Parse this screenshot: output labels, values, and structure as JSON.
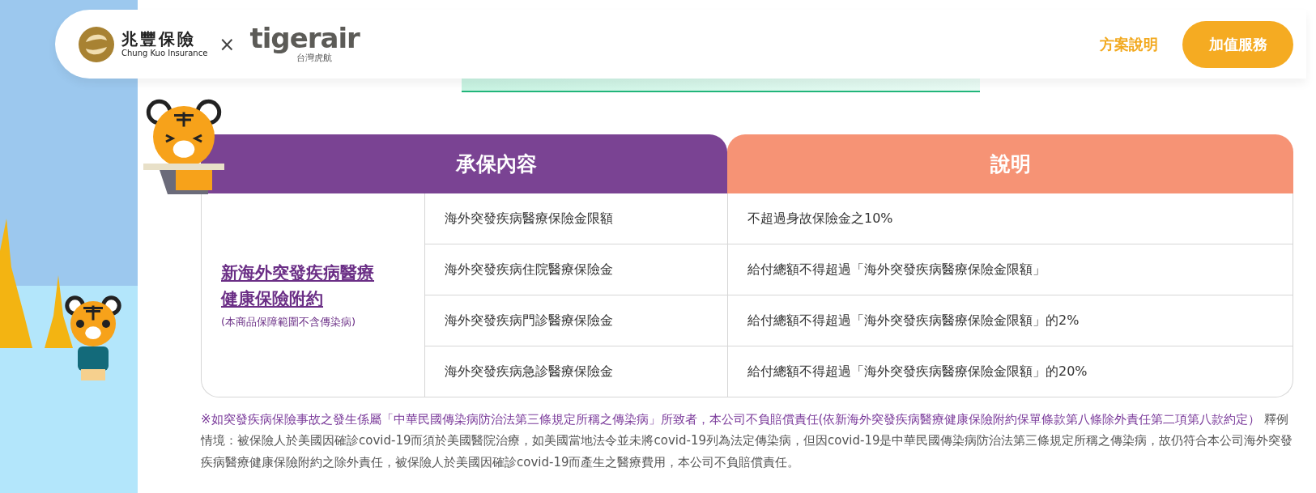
{
  "header": {
    "brand": {
      "name": "兆豐保險",
      "subtitle": "Chung Kuo Insurance"
    },
    "separator": "×",
    "partner": {
      "name": "tigerair",
      "subtitle": "台灣虎航"
    },
    "nav": [
      {
        "label": "方案說明",
        "kind": "link"
      },
      {
        "label": "加值服務",
        "kind": "button"
      }
    ]
  },
  "table": {
    "columns": [
      "承保內容",
      "說明"
    ],
    "plan": {
      "title": "新海外突發疾病醫療健康保險附約",
      "note": "(本商品保障範圍不含傳染病)"
    },
    "rows": [
      {
        "item": "海外突發疾病醫療保險金限額",
        "description": "不超過身故保險金之10%"
      },
      {
        "item": "海外突發疾病住院醫療保險金",
        "description": "給付總額不得超過「海外突發疾病醫療保險金限額」"
      },
      {
        "item": "海外突發疾病門診醫療保險金",
        "description": "給付總額不得超過「海外突發疾病醫療保險金限額」的2%"
      },
      {
        "item": "海外突發疾病急診醫療保險金",
        "description": "給付總額不得超過「海外突發疾病醫療保險金限額」的20%"
      }
    ]
  },
  "footnote": {
    "highlight": "※如突發疾病保險事故之發生係屬「中華民國傳染病防治法第三條規定所稱之傳染病」所致者，本公司不負賠償責任(依新海外突發疾病醫療健康保險附約保單條款第八條除外責任第二項第八款約定）",
    "text": "釋例情境：被保險人於美國因確診covid-19而須於美國醫院治療，如美國當地法令並未將covid-19列為法定傳染病，但因covid-19是中華民國傳染病防治法第三條規定所稱之傳染病，故仍符合本公司海外突發疾病醫療健康保險附約之除外責任，被保險人於美國因確診covid-19而產生之醫療費用，本公司不負賠償責任。"
  }
}
